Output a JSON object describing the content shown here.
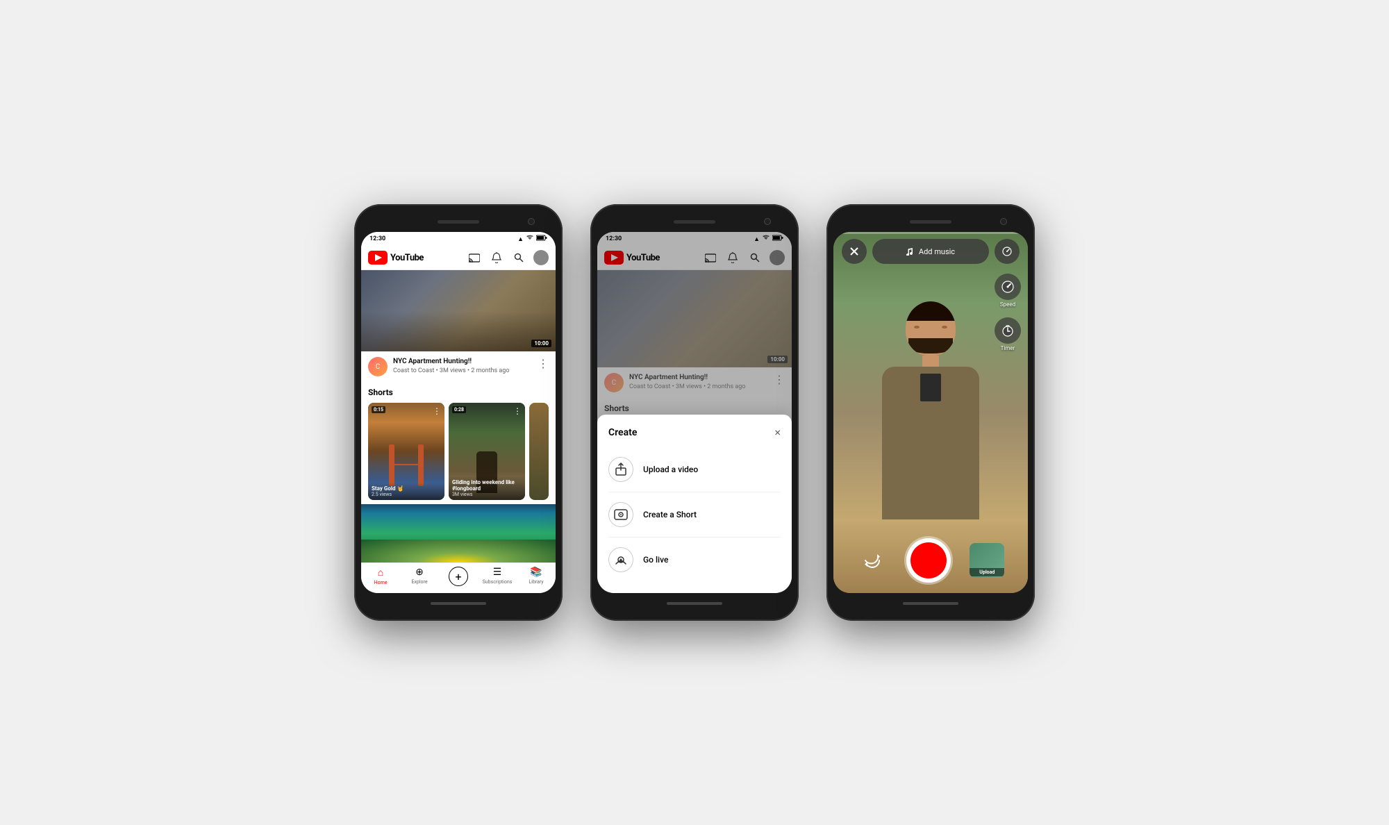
{
  "phones": {
    "phone1": {
      "status_bar": {
        "time": "12:30",
        "signal": "▲",
        "wifi": "WiFi",
        "battery": "Battery"
      },
      "header": {
        "logo_text": "YouTube",
        "cast_icon": "cast-icon",
        "bell_icon": "bell-icon",
        "search_icon": "search-icon",
        "avatar_icon": "avatar-icon"
      },
      "video": {
        "duration": "10:00",
        "title": "NYC Apartment Hunting!!",
        "channel": "Coast to Coast",
        "meta": "3M views • 2 months ago"
      },
      "shorts": {
        "section_title": "Shorts",
        "items": [
          {
            "duration": "0:15",
            "title": "Stay Gold 🤘",
            "views": "2.5 views"
          },
          {
            "duration": "0:28",
            "title": "Gliding into weekend like #longboard",
            "views": "3M views"
          }
        ]
      },
      "bottom_nav": {
        "items": [
          {
            "label": "Home",
            "active": true
          },
          {
            "label": "Explore",
            "active": false
          },
          {
            "label": "",
            "active": false,
            "is_create": true
          },
          {
            "label": "Subscriptions",
            "active": false
          },
          {
            "label": "Library",
            "active": false
          }
        ]
      }
    },
    "phone2": {
      "modal": {
        "title": "Create",
        "close_label": "×",
        "items": [
          {
            "icon": "upload-icon",
            "label": "Upload a video"
          },
          {
            "icon": "camera-icon",
            "label": "Create a Short"
          },
          {
            "icon": "live-icon",
            "label": "Go live"
          }
        ]
      }
    },
    "phone3": {
      "add_music_label": "Add music",
      "speed_label": "Speed",
      "timer_label": "Timer",
      "upload_label": "Upload",
      "progress_bar_width": "0"
    }
  }
}
